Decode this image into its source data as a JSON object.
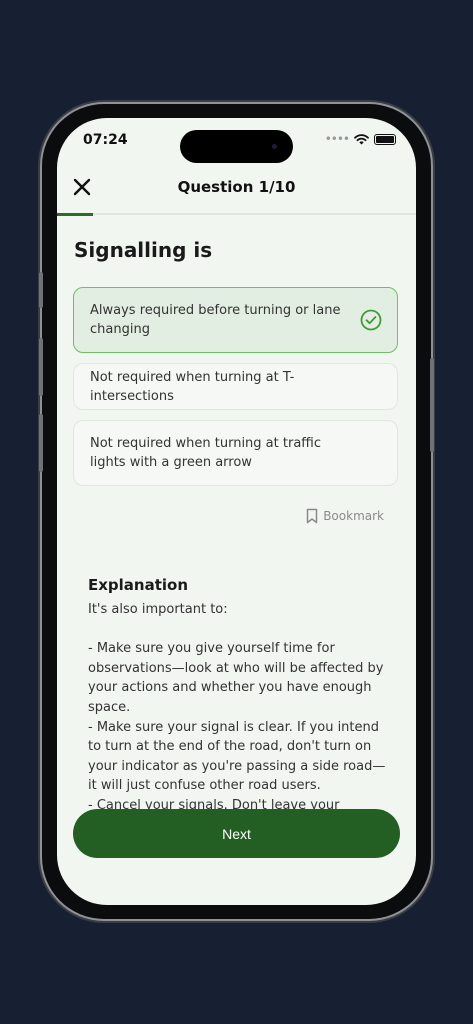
{
  "status_bar": {
    "time": "07:24"
  },
  "header": {
    "title": "Question 1/10",
    "progress": 0.1
  },
  "question": {
    "text": "Signalling is"
  },
  "options": [
    {
      "text": "Always required before turning or lane changing",
      "state": "correct"
    },
    {
      "text": "Not required when turning at T-intersections",
      "state": "default"
    },
    {
      "text": "Not required when turning at traffic lights with a green arrow",
      "state": "default"
    }
  ],
  "bookmark": {
    "label": "Bookmark"
  },
  "explanation": {
    "title": "Explanation",
    "body": "It's also important to:\n\n- Make sure you give yourself time for observations—look at who will be affected by your actions and whether you have enough space.\n- Make sure your signal is clear. If you intend to turn at the end of the road, don't turn on your indicator as you're passing a side road—it will just confuse other road users.\n- Cancel your signals. Don't leave your"
  },
  "next_button": {
    "label": "Next"
  },
  "colors": {
    "background": "#172033",
    "screen": "#f2f6f1",
    "accent": "#235e22",
    "correct_border": "#6fbf66",
    "correct_bg": "#e3eee2"
  }
}
